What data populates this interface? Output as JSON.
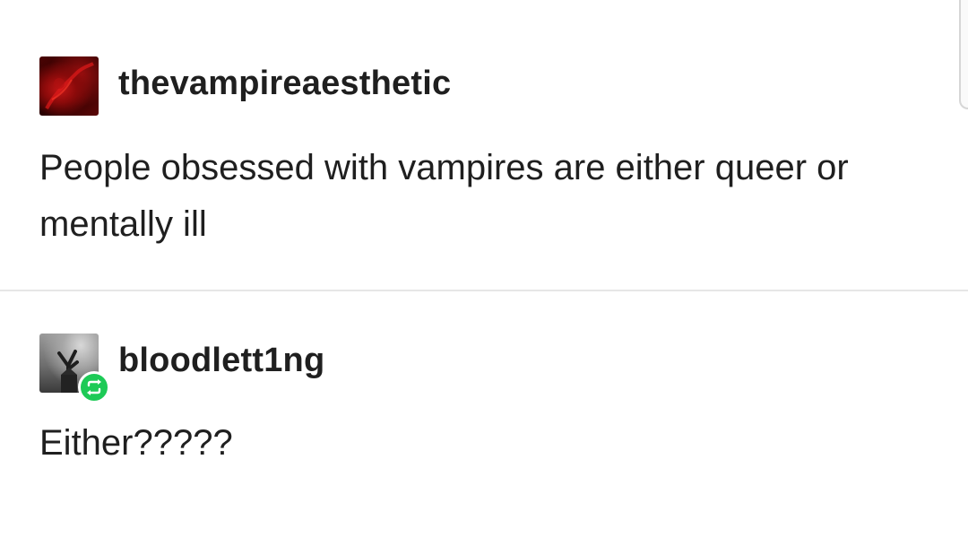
{
  "posts": [
    {
      "username": "thevampireaesthetic",
      "avatar_icon": "dark-red-abstract-avatar",
      "text": "People obsessed with vampires are either queer or mentally ill"
    },
    {
      "username": "bloodlett1ng",
      "avatar_icon": "gothic-tree-avatar",
      "badge_icon": "reblog-icon",
      "badge_color": "#1dca56",
      "text": "Either?????"
    }
  ],
  "colors": {
    "background": "#ffffff",
    "text": "#1f1f1f",
    "divider": "#e6e6e6"
  }
}
